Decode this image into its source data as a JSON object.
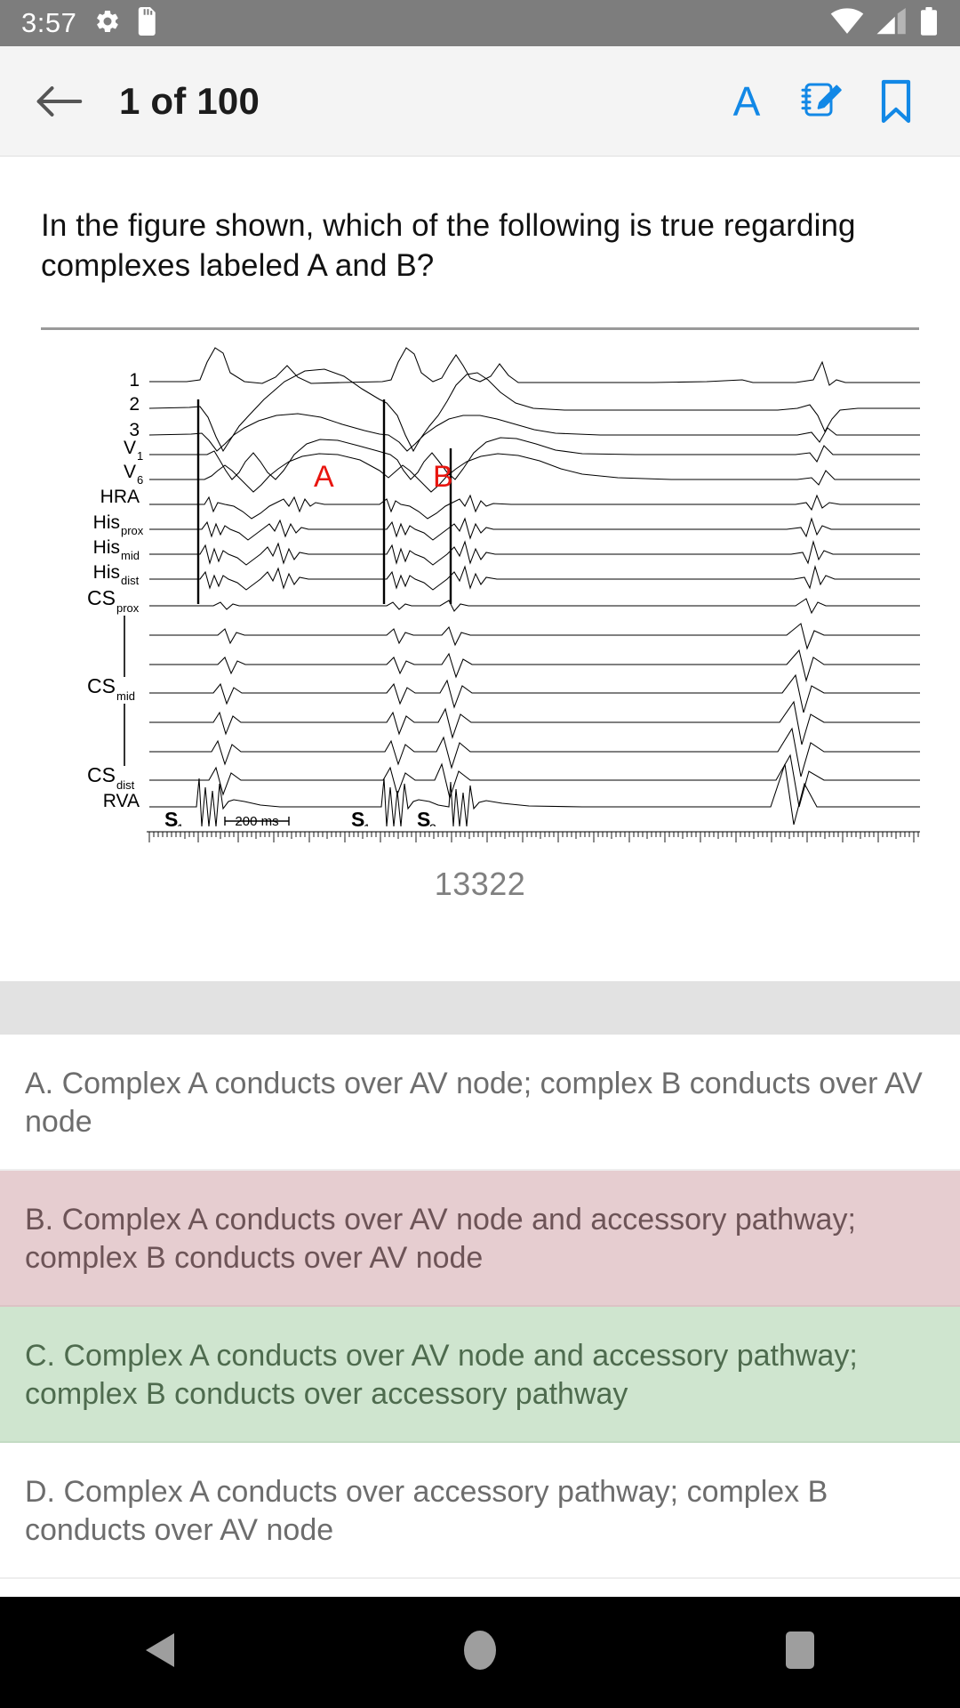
{
  "status_bar": {
    "time": "3:57",
    "icons": [
      "gear-icon",
      "sd-card-icon",
      "wifi-icon",
      "cell-signal-icon",
      "battery-icon"
    ],
    "background": "#7d7d7d"
  },
  "toolbar": {
    "back_label": "back-arrow",
    "title": "1 of 100",
    "font_size_label": "A",
    "notes_label": "notepad-pencil",
    "bookmark_label": "bookmark",
    "accent_color": "#1288e6",
    "background": "#f4f4f4"
  },
  "question": {
    "text": "In the figure shown, which of the following is true regarding complexes labeled A and B?"
  },
  "figure": {
    "caption": "13322",
    "channel_labels": [
      {
        "main": "1",
        "sub": ""
      },
      {
        "main": "2",
        "sub": ""
      },
      {
        "main": "3",
        "sub": ""
      },
      {
        "main": "V",
        "sub": "1"
      },
      {
        "main": "V",
        "sub": "6"
      },
      {
        "main": "HRA",
        "sub": ""
      },
      {
        "main": "His",
        "sub": "prox"
      },
      {
        "main": "His",
        "sub": "mid"
      },
      {
        "main": "His",
        "sub": "dist"
      },
      {
        "main": "CS",
        "sub": "prox"
      },
      {
        "main": "CS",
        "sub": "mid"
      },
      {
        "main": "CS",
        "sub": "dist"
      },
      {
        "main": "RVA",
        "sub": ""
      }
    ],
    "annotations": [
      {
        "label": "A",
        "color": "#e8150f"
      },
      {
        "label": "B",
        "color": "#e8150f"
      }
    ],
    "stim_markers": [
      {
        "label": "S",
        "sub": "1"
      },
      {
        "label": "S",
        "sub": "1"
      },
      {
        "label": "S",
        "sub": "2"
      }
    ],
    "scale_bar": "200 ms"
  },
  "answers": [
    {
      "text": "A. Complex A conducts over AV node; complex B conducts over AV node",
      "state": "normal"
    },
    {
      "text": "B. Complex A conducts over AV node and accessory pathway; complex B conducts over AV node",
      "state": "selected"
    },
    {
      "text": "C. Complex A conducts over AV node and accessory pathway; complex B conducts over accessory pathway",
      "state": "correct"
    },
    {
      "text": "D. Complex A conducts over accessory pathway; complex B conducts over AV node",
      "state": "normal"
    }
  ],
  "nav_bar": {
    "back": "triangle-back-icon",
    "home": "circle-home-icon",
    "recents": "square-recents-icon",
    "background": "#000000"
  }
}
